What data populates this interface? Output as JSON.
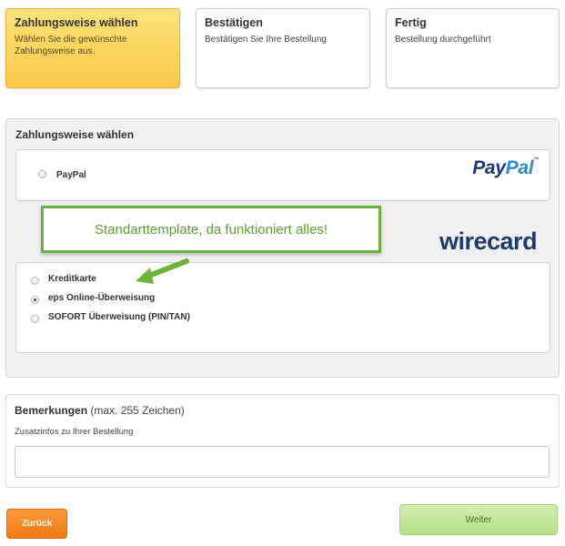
{
  "steps": [
    {
      "title": "Zahlungsweise wählen",
      "desc": "Wählen Sie die gewünschte Zahlungsweise aus."
    },
    {
      "title": "Bestätigen",
      "desc": "Bestätigen Sie Ihre Bestellung"
    },
    {
      "title": "Fertig",
      "desc": "Bestellung durchgeführt"
    }
  ],
  "payment": {
    "title": "Zahlungsweise wählen",
    "paypal": {
      "label": "PayPal",
      "logo_a": "Pay",
      "logo_b": "Pal",
      "logo_tm": "™",
      "selected": false
    },
    "wirecard": {
      "logo": "wirecard",
      "options": [
        {
          "label": "Kreditkarte",
          "selected": false
        },
        {
          "label": "eps Online-Überweisung",
          "selected": true
        },
        {
          "label": "SOFORT Überweisung (PIN/TAN)",
          "selected": false
        }
      ]
    }
  },
  "callout": {
    "text": "Standarttemplate, da funktioniert alles!"
  },
  "remarks": {
    "title": "Bemerkungen",
    "title_extra": "(max. 255 Zeichen)",
    "hint": "Zusatzinfos zu Ihrer Bestellung",
    "value": ""
  },
  "buttons": {
    "back": "Zurück",
    "next": "Weiter"
  },
  "colors": {
    "active_step": "#f8c947",
    "back_button": "#f07a10",
    "next_button": "#b5e087",
    "callout_border": "#6bb33a",
    "wirecard": "#1c3d6b"
  }
}
